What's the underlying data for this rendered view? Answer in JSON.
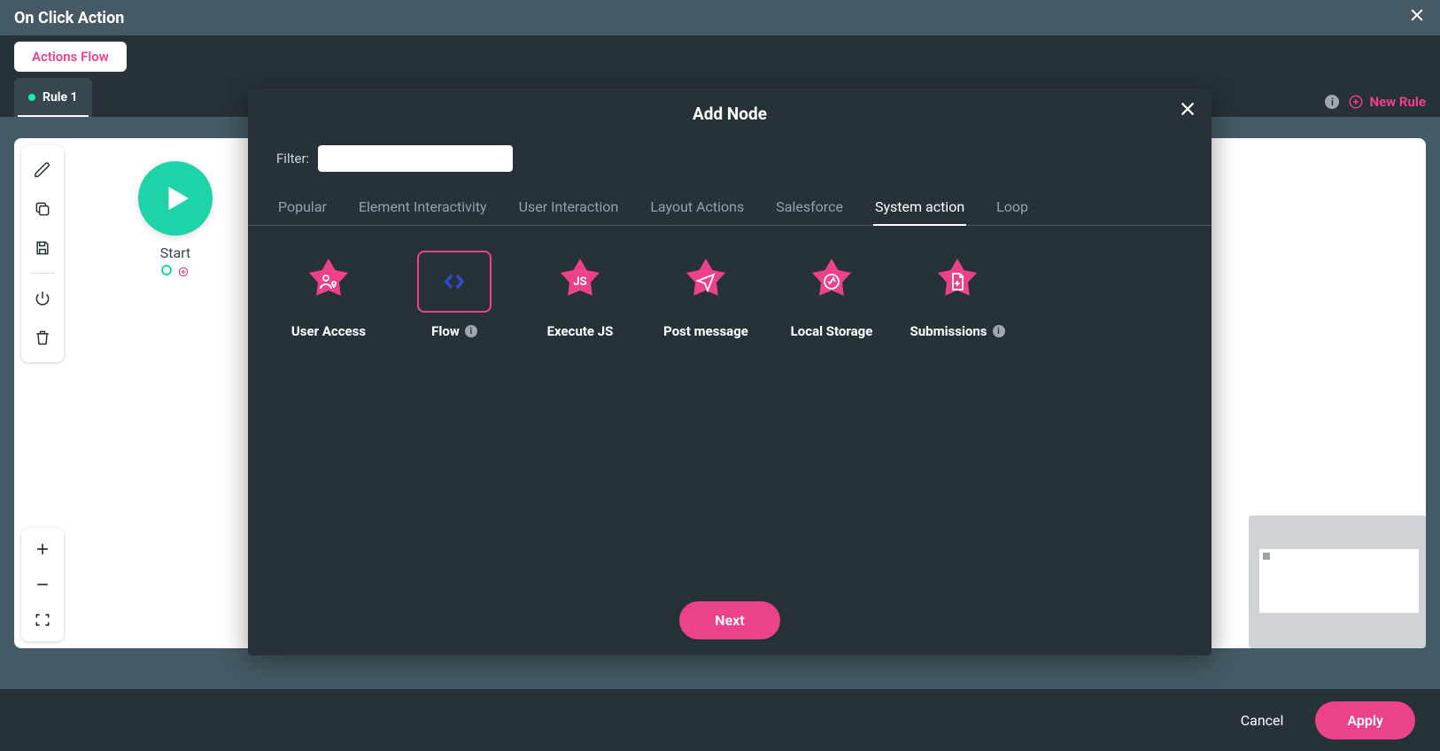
{
  "header": {
    "title": "On Click Action"
  },
  "subheader": {
    "actionsFlow": "Actions Flow"
  },
  "rulebar": {
    "rule1": "Rule 1",
    "newRule": "New Rule"
  },
  "canvas": {
    "startLabel": "Start"
  },
  "modal": {
    "title": "Add Node",
    "filterLabel": "Filter:",
    "filterValue": "",
    "tabs": {
      "popular": "Popular",
      "elementInteractivity": "Element Interactivity",
      "userInteraction": "User Interaction",
      "layoutActions": "Layout Actions",
      "salesforce": "Salesforce",
      "systemAction": "System action",
      "loop": "Loop"
    },
    "nodes": {
      "userAccess": "User Access",
      "flow": "Flow",
      "executeJs": "Execute JS",
      "postMessage": "Post message",
      "localStorage": "Local Storage",
      "submissions": "Submissions"
    },
    "next": "Next"
  },
  "footer": {
    "cancel": "Cancel",
    "apply": "Apply"
  },
  "colors": {
    "accent": "#ec418b",
    "teal": "#1dd3a7",
    "panel": "#263238",
    "panelLight": "#37474f"
  }
}
